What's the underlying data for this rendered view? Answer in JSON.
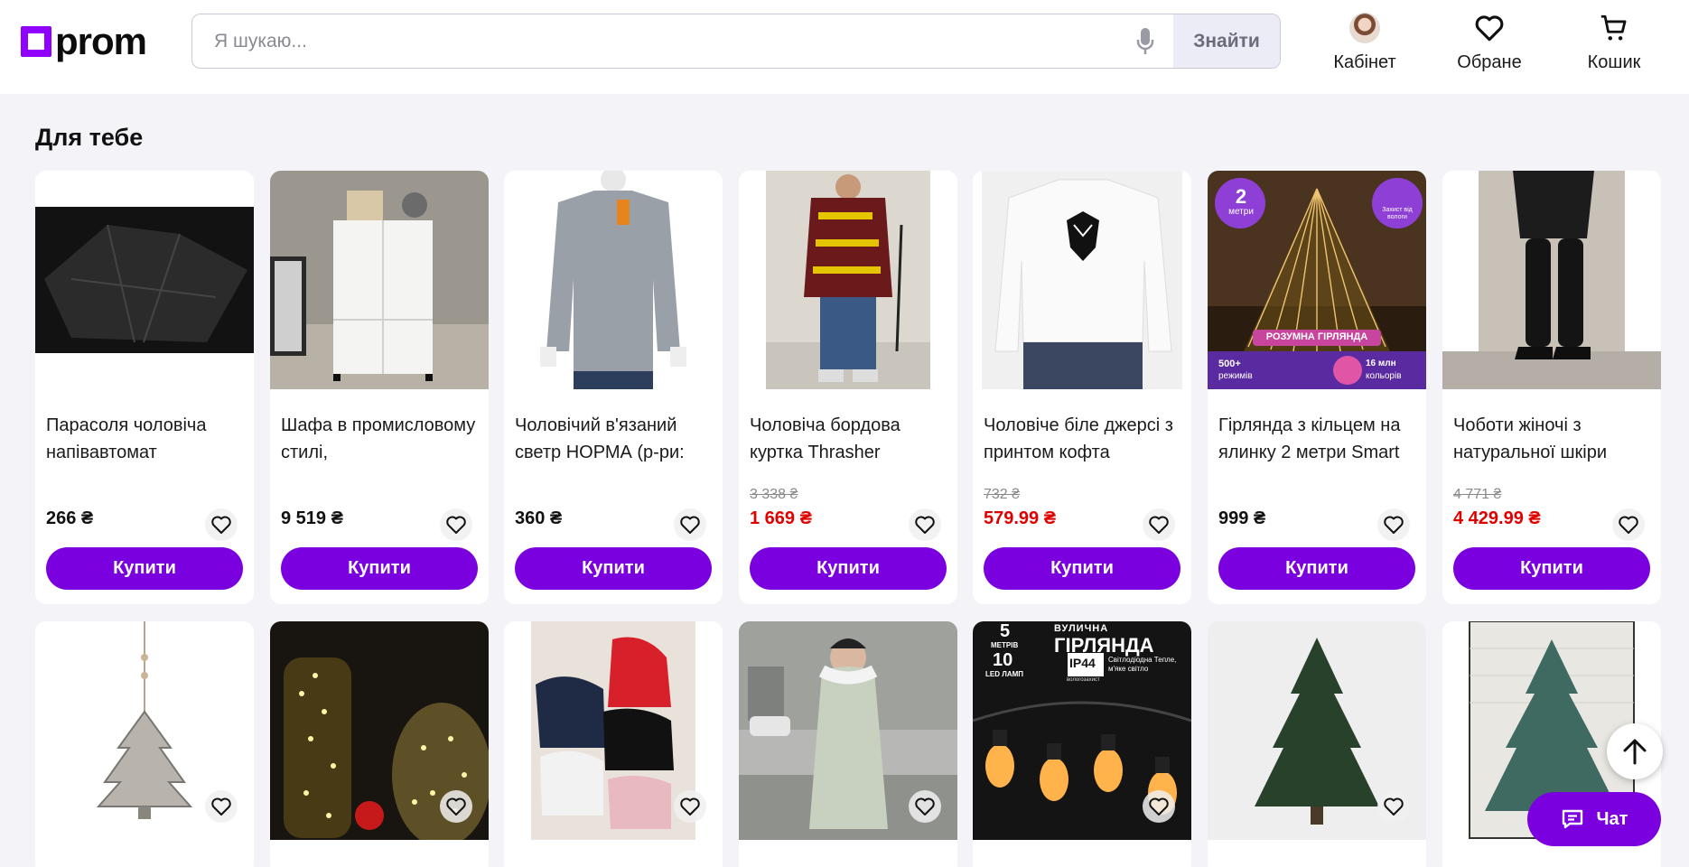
{
  "header": {
    "logo_text": "prom",
    "search_placeholder": "Я шукаю...",
    "search_button": "Знайти",
    "cabinet_label": "Кабінет",
    "favorites_label": "Обране",
    "cart_label": "Кошик"
  },
  "section": {
    "title": "Для тебе"
  },
  "buy_label": "Купити",
  "products_row1": [
    {
      "title": "Парасоля чоловіча напівавтомат",
      "price": "266 ₴",
      "old_price": "",
      "sale": false,
      "image": "umbrella"
    },
    {
      "title": "Шафа в промисловому стилі,",
      "price": "9 519 ₴",
      "old_price": "",
      "sale": false,
      "image": "cabinet"
    },
    {
      "title": "Чоловічий в'язаний светр НОРМА (р-ри:",
      "price": "360 ₴",
      "old_price": "",
      "sale": false,
      "image": "sweater"
    },
    {
      "title": "Чоловіча бордова куртка Thrasher",
      "price": "1 669 ₴",
      "old_price": "3 338 ₴",
      "sale": true,
      "image": "jacket"
    },
    {
      "title": "Чоловіче біле джерсі з принтом кофта",
      "price": "579.99 ₴",
      "old_price": "732 ₴",
      "sale": true,
      "image": "white-sweatshirt"
    },
    {
      "title": "Гірлянда з кільцем на ялинку 2 метри Smart",
      "price": "999 ₴",
      "old_price": "",
      "sale": false,
      "image": "garland"
    },
    {
      "title": "Чоботи жіночі з натуральної шкіри",
      "price": "4 429.99 ₴",
      "old_price": "4 771 ₴",
      "sale": true,
      "image": "boots"
    }
  ],
  "garland_badges": {
    "top_left_num": "2",
    "top_left_unit": "метри",
    "banner": "РОЗУМНА ГІРЛЯНДА",
    "modes_num": "500+",
    "modes_label": "режимів",
    "colors_num": "16 млн",
    "colors_label": "кольорів",
    "water": "Захист від вологи"
  },
  "street_garland_text": {
    "line1": "ВУЛИЧНА",
    "line2": "ГІРЛЯНДА",
    "meters": "5",
    "meters_unit": "МЕТРІВ",
    "lamps": "10",
    "lamps_unit": "LED ЛАМП",
    "ip": "IP44",
    "ip_sub": "вологозахист",
    "desc": "Світлодіодна Тепле, м'яке світло"
  },
  "chat_label": "Чат",
  "colors": {
    "brand": "#7b00e0",
    "logo": "#8f00ff",
    "sale": "#e10000"
  }
}
